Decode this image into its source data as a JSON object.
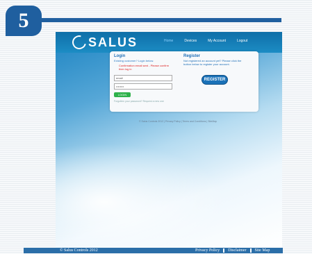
{
  "step_number": "5",
  "salus_logo": "SALUS",
  "nav": [
    "Home",
    "Devices",
    "My Account",
    "Logout"
  ],
  "login": {
    "title": "Login",
    "subtitle": "Existing customer? Login below.",
    "message": "Confirmation email sent - Please confirm then log in",
    "email_value": "email",
    "password_value": "••••••••",
    "button_label": "LOGIN",
    "forgot_text": "Forgotten your password? Request a new one"
  },
  "register": {
    "title": "Register",
    "text": "Not registered an account yet? Please click the button below to register your account.",
    "button_label": "REGISTER"
  },
  "inner_footer": "© Salus Controls 2012 | Privacy Policy | Terms and Conditions | SiteMap",
  "footer": {
    "copyright": "© Salus Controls 2012",
    "links": [
      "Privacy Policy",
      "Disclaimer",
      "Site Map"
    ]
  },
  "colors": {
    "primary": "#1f5f9f",
    "header": "#0f6fa8",
    "login_button": "#2eb14b",
    "error": "#dd2222"
  }
}
